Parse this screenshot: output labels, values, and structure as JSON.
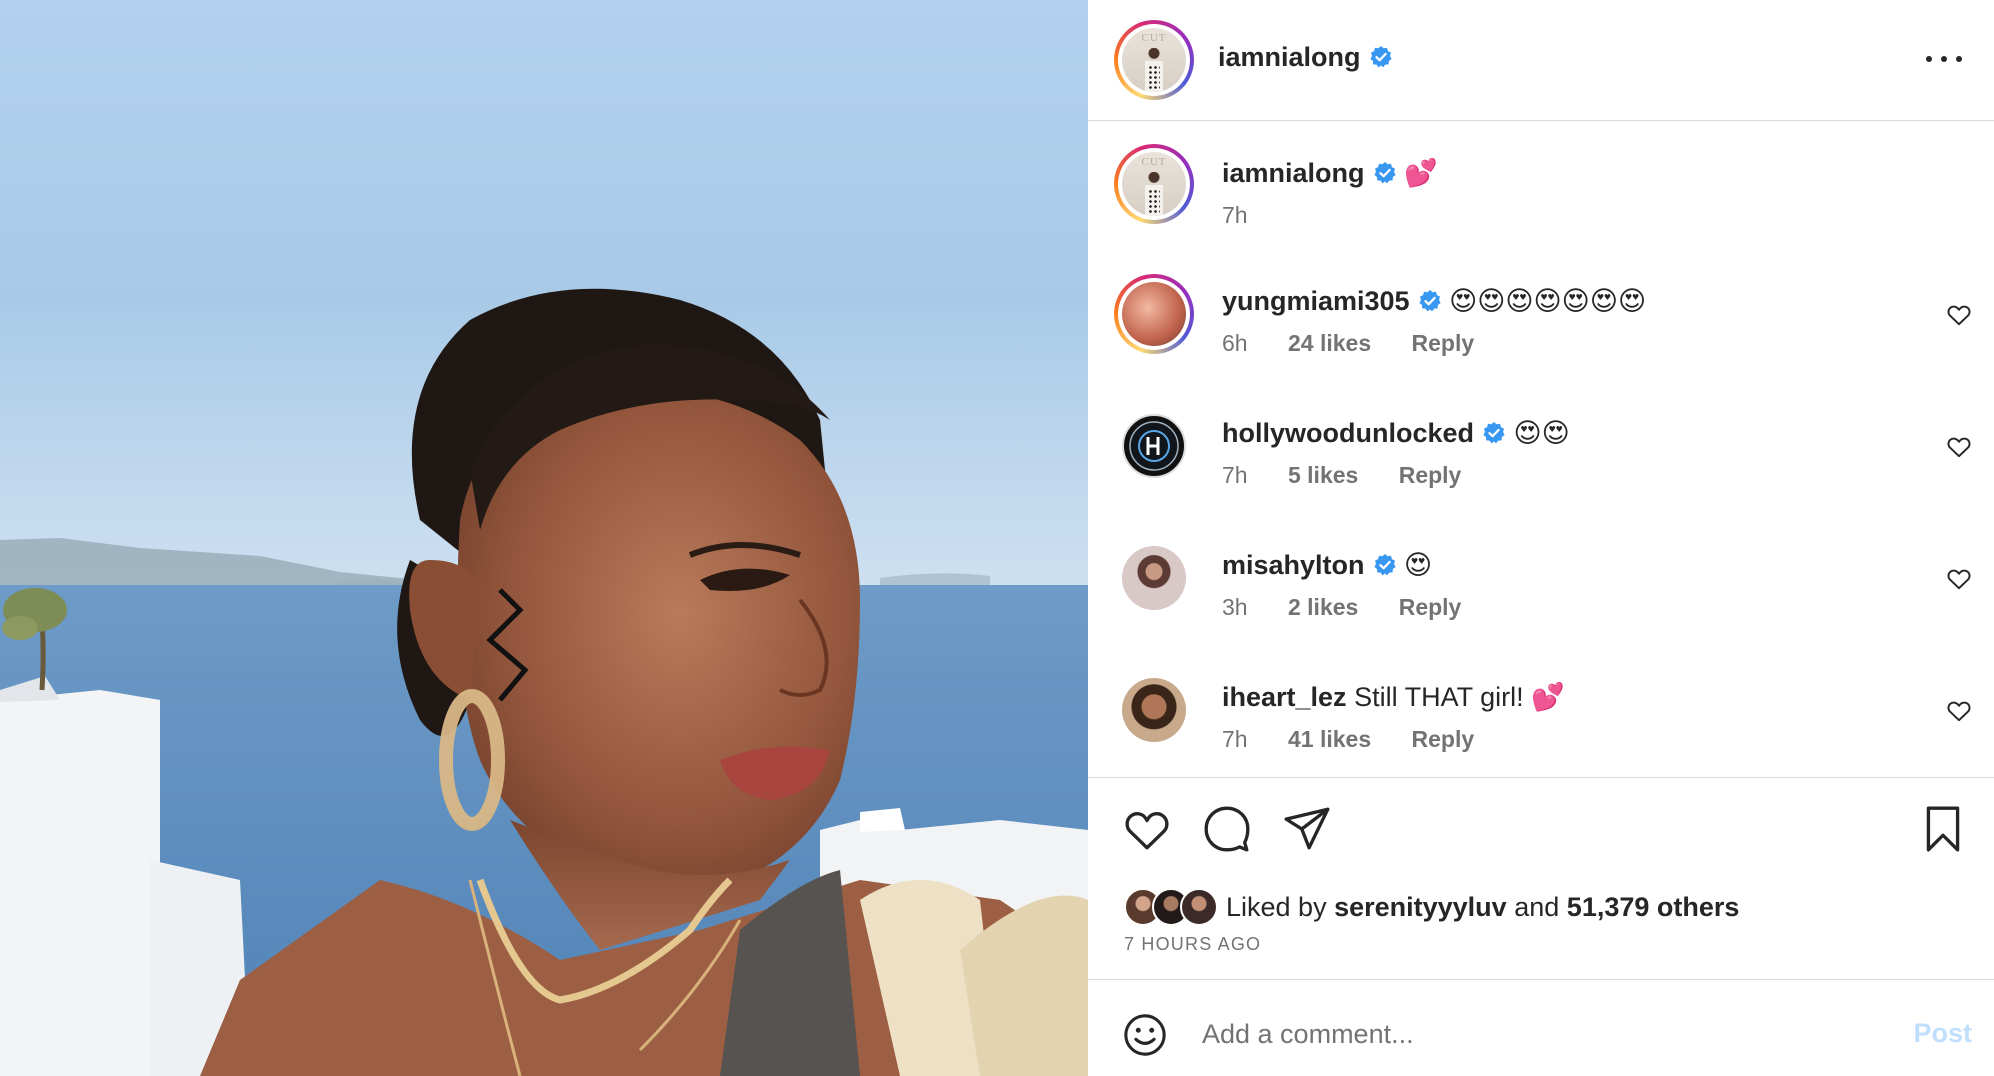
{
  "post": {
    "author": "iamnialong",
    "verified": true,
    "caption_emoji": "💕",
    "caption_time": "7h",
    "more_icon": "more-horizontal-icon"
  },
  "comments": [
    {
      "username": "yungmiami305",
      "verified": true,
      "text": "😍😍😍😍😍😍😍",
      "time": "6h",
      "likes": "24 likes",
      "reply": "Reply"
    },
    {
      "username": "hollywoodunlocked",
      "verified": true,
      "text": "😍😍",
      "time": "7h",
      "likes": "5 likes",
      "reply": "Reply"
    },
    {
      "username": "misahylton",
      "verified": true,
      "text": "😍",
      "time": "3h",
      "likes": "2 likes",
      "reply": "Reply"
    },
    {
      "username": "iheart_lez",
      "verified": false,
      "text": "Still THAT girl! 💕",
      "time": "7h",
      "likes": "41 likes",
      "reply": "Reply"
    }
  ],
  "actions": {
    "like_icon": "heart-icon",
    "comment_icon": "comment-bubble-icon",
    "share_icon": "paper-plane-icon",
    "save_icon": "bookmark-icon"
  },
  "likes": {
    "prefix": "Liked by",
    "user": "serenityyyluv",
    "and": "and",
    "others": "51,379 others"
  },
  "timestamp": "7 HOURS AGO",
  "add_comment": {
    "placeholder": "Add a comment...",
    "post_label": "Post"
  },
  "colors": {
    "verified_blue": "#3897f0",
    "post_disabled": "#c0dffd",
    "muted_text": "#737373"
  }
}
